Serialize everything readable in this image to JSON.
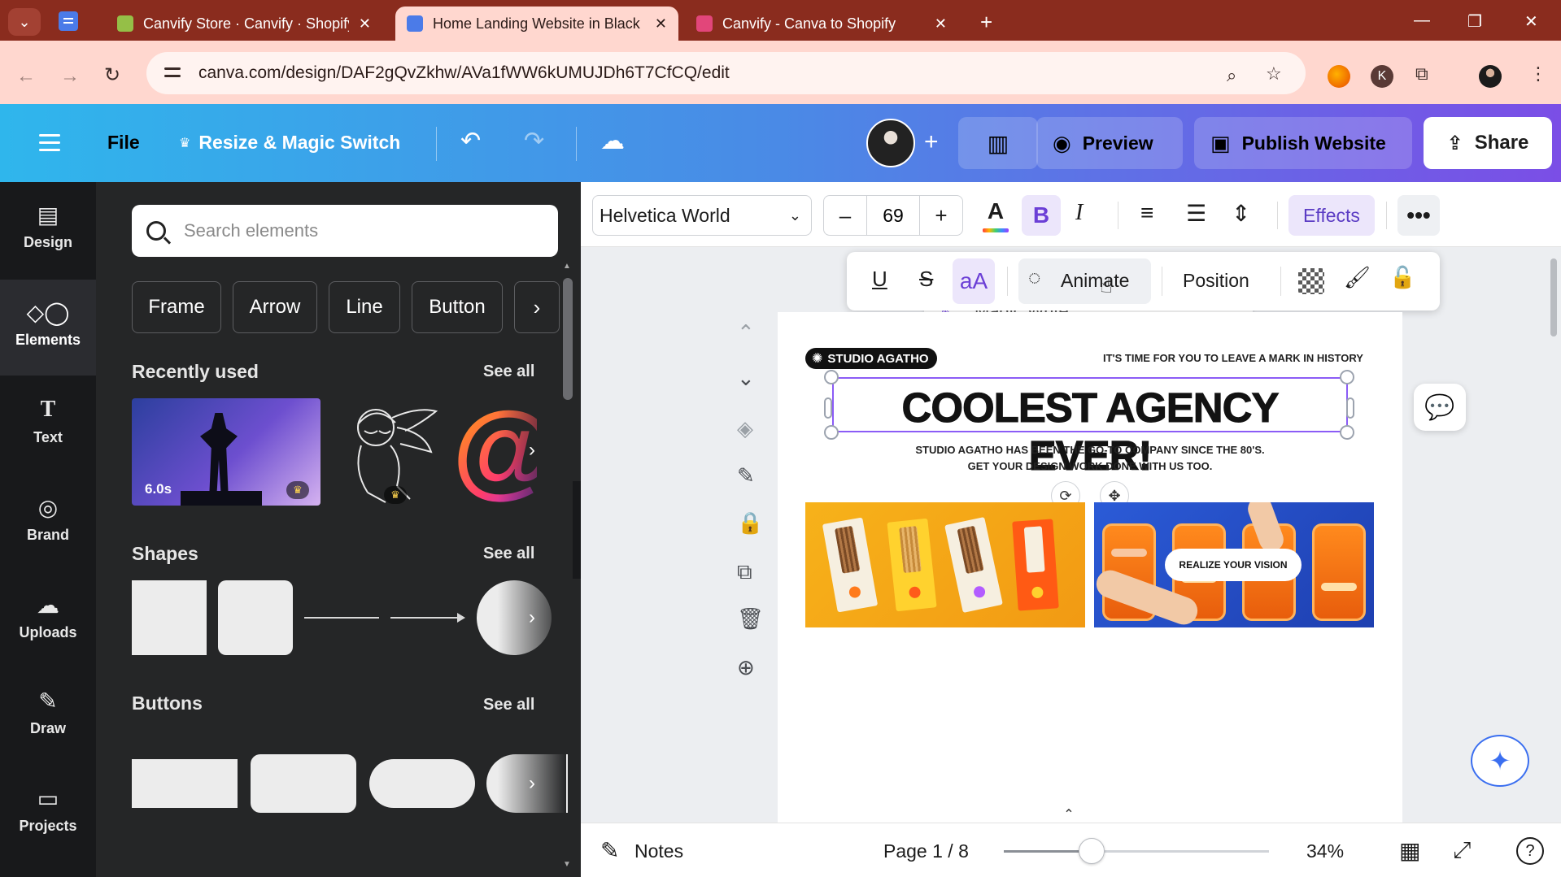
{
  "browser": {
    "tabs": [
      {
        "title": "Canvify Store · Canvify · Shopify",
        "favicon_color": "#95bf47"
      },
      {
        "title": "Home Landing Website in Black",
        "favicon_color": "#4b7be8",
        "active": true
      },
      {
        "title": "Canvify - Canva to Shopify",
        "favicon_color": "#e2467a"
      }
    ],
    "tab_close": "✕",
    "new_tab": "+",
    "window": {
      "minimize": "—",
      "restore": "❐",
      "close": "✕"
    },
    "url": "canva.com/design/DAF2gQvZkhw/AVa1fWW6kUMUJDh6T7CfCQ/edit"
  },
  "topbar": {
    "file_label": "File",
    "resize_label": "Resize & Magic Switch",
    "add_label": "+",
    "preview_label": "Preview",
    "publish_label": "Publish Website",
    "share_label": "Share"
  },
  "rail": {
    "items": [
      {
        "label": "Design",
        "icon": "design-icon"
      },
      {
        "label": "Elements",
        "icon": "elements-icon",
        "active": true
      },
      {
        "label": "Text",
        "icon": "text-icon"
      },
      {
        "label": "Brand",
        "icon": "brand-icon"
      },
      {
        "label": "Uploads",
        "icon": "uploads-icon"
      },
      {
        "label": "Draw",
        "icon": "draw-icon"
      },
      {
        "label": "Projects",
        "icon": "projects-icon"
      }
    ]
  },
  "panel": {
    "search_placeholder": "Search elements",
    "chips": [
      "Frame",
      "Arrow",
      "Line",
      "Button"
    ],
    "recently_used": {
      "title": "Recently used",
      "see_all": "See all",
      "video_duration": "6.0s"
    },
    "shapes": {
      "title": "Shapes",
      "see_all": "See all"
    },
    "buttons": {
      "title": "Buttons",
      "see_all": "See all"
    }
  },
  "format_bar": {
    "font": "Helvetica World",
    "size": "69",
    "minus": "–",
    "plus": "+",
    "effects_label": "Effects"
  },
  "floating_bar": {
    "animate_label": "Animate",
    "position_label": "Position",
    "aa_label": "aA",
    "magic_write_label": "Magic Write"
  },
  "canvas": {
    "badge": "STUDIO AGATHO",
    "tagline": "IT'S TIME FOR YOU TO LEAVE A MARK IN HISTORY",
    "headline": "COOLEST AGENCY EVER!",
    "subline_1": "STUDIO AGATHO HAS BEEN THE GO-TO COMPANY SINCE THE 80'S.",
    "subline_2": "GET YOUR DESIGN WORK DONE WITH US TOO.",
    "vision_label": "REALIZE YOUR VISION"
  },
  "bottom": {
    "notes_label": "Notes",
    "page_indicator": "Page 1 / 8",
    "zoom": "34%",
    "zoom_fraction": 0.33
  },
  "colors": {
    "browser_tabbar": "#8a2c1e",
    "browser_address": "#ffd7cf",
    "canva_gradient_start": "#2fb6ec",
    "canva_gradient_end": "#7b4ee6",
    "selection": "#8b5cf6"
  }
}
